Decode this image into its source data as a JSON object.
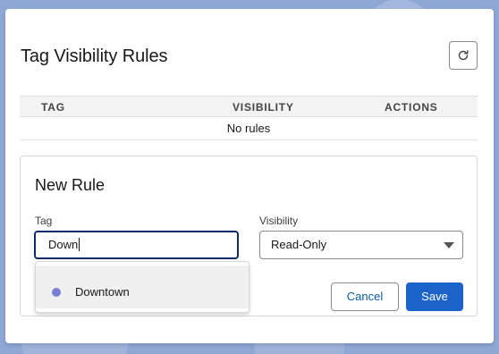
{
  "panel": {
    "title": "Tag Visibility Rules",
    "refresh_icon": "refresh-icon"
  },
  "table": {
    "columns": [
      "TAG",
      "VISIBILITY",
      "ACTIONS"
    ],
    "empty_message": "No rules"
  },
  "new_rule": {
    "title": "New Rule",
    "tag_label": "Tag",
    "tag_value": "Down",
    "visibility_label": "Visibility",
    "visibility_value": "Read-Only",
    "cancel_label": "Cancel",
    "save_label": "Save"
  },
  "suggestions": [
    {
      "label": "Downtown",
      "color": "#7b7fd4"
    }
  ],
  "colors": {
    "primary": "#1b63c9",
    "link": "#0b5cab",
    "focus_border": "#0b2e6b"
  }
}
